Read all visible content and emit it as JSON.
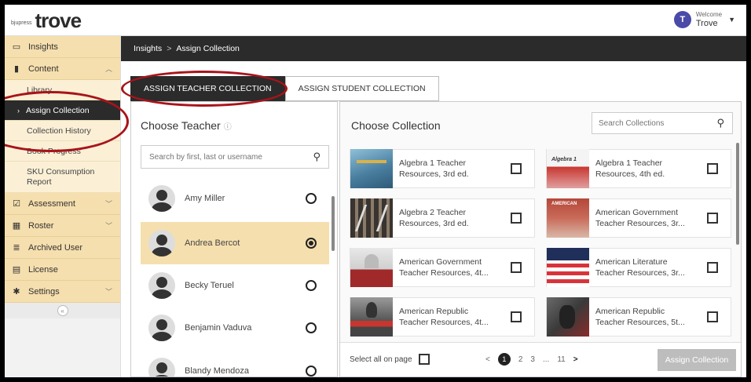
{
  "header": {
    "logo_small": "bjupress",
    "logo_big": "trove",
    "avatar_letter": "T",
    "welcome_label": "Welcome",
    "user_name": "Trove"
  },
  "sidebar": {
    "items": [
      {
        "label": "Insights",
        "icon": "monitor-icon"
      },
      {
        "label": "Content",
        "icon": "book-icon",
        "has_chevron": true
      },
      {
        "label": "Assessment",
        "icon": "checkbox-icon",
        "has_chevron": true
      },
      {
        "label": "Roster",
        "icon": "calendar-icon",
        "has_chevron": true
      },
      {
        "label": "Archived User",
        "icon": "list-icon"
      },
      {
        "label": "License",
        "icon": "card-icon"
      },
      {
        "label": "Settings",
        "icon": "gear-icon",
        "has_chevron": true
      }
    ],
    "content_sub": [
      {
        "label": "Library"
      },
      {
        "label": "Assign Collection",
        "active": true
      },
      {
        "label": "Collection History"
      },
      {
        "label": "Book Progress"
      },
      {
        "label": "SKU Consumption Report"
      }
    ],
    "collapse_glyph": "«"
  },
  "breadcrumb": {
    "parent": "Insights",
    "separator": ">",
    "current": "Assign Collection"
  },
  "tabs": [
    {
      "label": "ASSIGN TEACHER COLLECTION",
      "active": true
    },
    {
      "label": "ASSIGN STUDENT COLLECTION",
      "active": false
    }
  ],
  "teacher_panel": {
    "title": "Choose Teacher",
    "search_placeholder": "Search by first, last or username",
    "teachers": [
      {
        "name": "Amy Miller",
        "selected": false
      },
      {
        "name": "Andrea Bercot",
        "selected": true
      },
      {
        "name": "Becky Teruel",
        "selected": false
      },
      {
        "name": "Benjamin Vaduva",
        "selected": false
      },
      {
        "name": "Blandy Mendoza",
        "selected": false
      }
    ]
  },
  "collection_panel": {
    "title": "Choose Collection",
    "search_placeholder": "Search Collections",
    "collections": [
      {
        "title": "Algebra 1 Teacher\nResources, 3rd ed.",
        "thumb_color": "#5a8fb0"
      },
      {
        "title": "Algebra 1 Teacher\nResources, 4th ed.",
        "thumb_color": "#c8362f"
      },
      {
        "title": "Algebra 2 Teacher\nResources, 3rd ed.",
        "thumb_color": "#6b5a48"
      },
      {
        "title": "American Government\nTeacher Resources, 3r...",
        "thumb_color": "#b5473a"
      },
      {
        "title": "American Government\nTeacher Resources, 4t...",
        "thumb_color": "#a02a2a"
      },
      {
        "title": "American Literature\nTeacher Resources, 3r...",
        "thumb_color": "#d8333a"
      },
      {
        "title": "American Republic\nTeacher Resources, 4t...",
        "thumb_color": "#555555"
      },
      {
        "title": "American Republic\nTeacher Resources, 5t...",
        "thumb_color": "#8a2a2a"
      }
    ],
    "select_all_label": "Select all on page",
    "pagination": {
      "prev": "<",
      "current": "1",
      "pages": [
        "2",
        "3"
      ],
      "ellipsis": "...",
      "last": "11",
      "next": ">"
    },
    "assign_button": "Assign Collection"
  }
}
